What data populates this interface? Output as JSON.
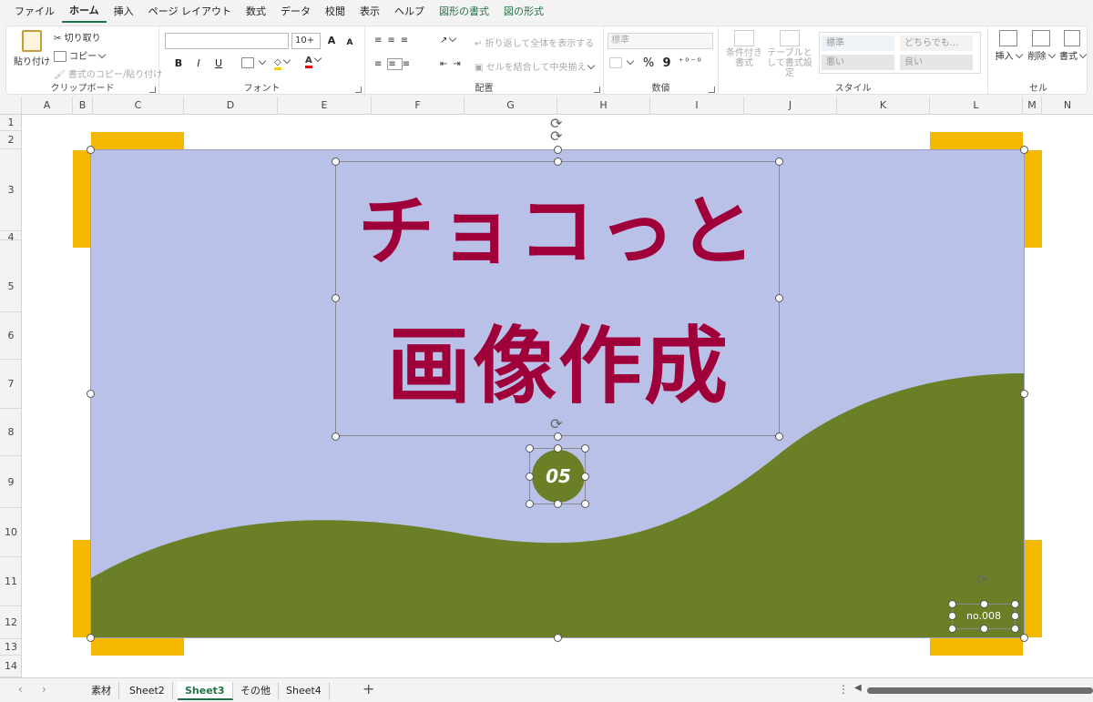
{
  "menu": {
    "items": [
      "ファイル",
      "ホーム",
      "挿入",
      "ページ レイアウト",
      "数式",
      "データ",
      "校閲",
      "表示",
      "ヘルプ",
      "図形の書式",
      "図の形式"
    ],
    "active_index": 1
  },
  "ribbon": {
    "clipboard": {
      "paste": "貼り付け",
      "cut": "切り取り",
      "copy": "コピー",
      "format_painter": "書式のコピー/貼り付け",
      "label": "クリップボード"
    },
    "font": {
      "font_name": "",
      "font_size": "10+",
      "bold": "B",
      "italic": "I",
      "underline": "U",
      "grow": "A",
      "shrink": "A",
      "color_letter": "A",
      "label": "フォント"
    },
    "alignment": {
      "wrap": "折り返して全体を表示する",
      "merge": "セルを結合して中央揃え",
      "label": "配置"
    },
    "number": {
      "format": "標準",
      "percent": "%",
      "comma": "9",
      "label": "数値"
    },
    "styles": {
      "conditional": "条件付き書式",
      "table": "テーブルとして書式設定",
      "cells": [
        "標準",
        "どちらでも...",
        "悪い",
        "良い"
      ],
      "label": "スタイル"
    },
    "cells": {
      "insert": "挿入",
      "delete": "削除",
      "format": "書式",
      "label": "セル"
    }
  },
  "columns": [
    "A",
    "B",
    "C",
    "D",
    "E",
    "F",
    "G",
    "H",
    "I",
    "J",
    "K",
    "L",
    "M",
    "N"
  ],
  "rows": [
    "1",
    "2",
    "3",
    "4",
    "5",
    "6",
    "7",
    "8",
    "9",
    "10",
    "11",
    "12",
    "13",
    "14"
  ],
  "slide": {
    "title_line1": "チョコっと",
    "title_line2": "画像作成",
    "badge": "05",
    "number_label": "no.008",
    "colors": {
      "background": "#bac1e8",
      "hill": "#6b7f27",
      "title": "#a0003a",
      "corner": "#f5b800"
    }
  },
  "sheets": {
    "tabs": [
      "素材",
      "Sheet2",
      "Sheet3",
      "その他",
      "Sheet4"
    ],
    "active_index": 2,
    "add": "+"
  }
}
